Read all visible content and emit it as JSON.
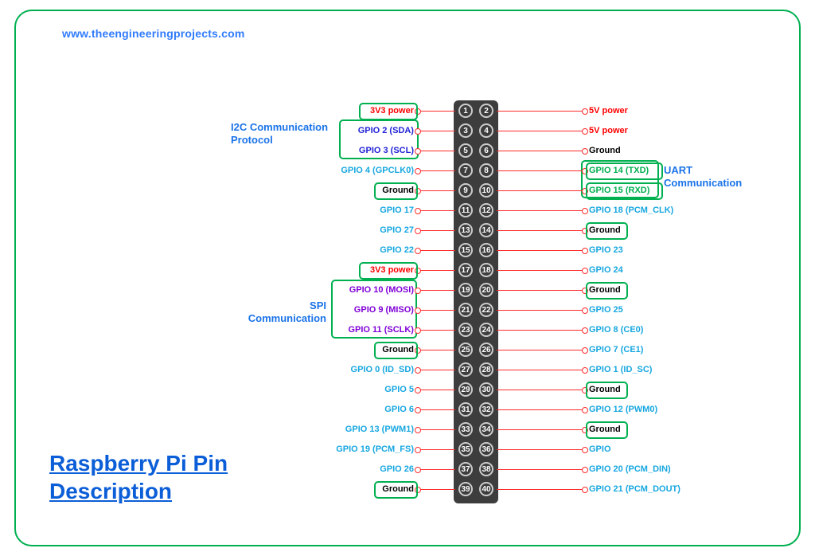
{
  "url": "www.theengineeringprojects.com",
  "title": "Raspberry Pi Pin Description",
  "groups": {
    "i2c": "I2C Communication Protocol",
    "spi": "SPI Communication",
    "uart": "UART Communication"
  },
  "rows": [
    {
      "l": {
        "n": 1,
        "t": "3V3 power",
        "c": "red",
        "box": 1
      },
      "r": {
        "n": 2,
        "t": "5V power",
        "c": "red"
      }
    },
    {
      "l": {
        "n": 3,
        "t": "GPIO 2 (SDA)",
        "c": "blue"
      },
      "r": {
        "n": 4,
        "t": "5V power",
        "c": "red"
      }
    },
    {
      "l": {
        "n": 5,
        "t": "GPIO 3 (SCL)",
        "c": "blue"
      },
      "r": {
        "n": 6,
        "t": "Ground",
        "c": "black"
      }
    },
    {
      "l": {
        "n": 7,
        "t": "GPIO 4 (GPCLK0)",
        "c": "cyan"
      },
      "r": {
        "n": 8,
        "t": "GPIO 14 (TXD)",
        "c": "green",
        "box": 1
      }
    },
    {
      "l": {
        "n": 9,
        "t": "Ground",
        "c": "black",
        "box": 1
      },
      "r": {
        "n": 10,
        "t": "GPIO 15 (RXD)",
        "c": "green",
        "box": 1
      }
    },
    {
      "l": {
        "n": 11,
        "t": "GPIO 17",
        "c": "cyan"
      },
      "r": {
        "n": 12,
        "t": "GPIO 18 (PCM_CLK)",
        "c": "cyan"
      }
    },
    {
      "l": {
        "n": 13,
        "t": "GPIO 27",
        "c": "cyan"
      },
      "r": {
        "n": 14,
        "t": "Ground",
        "c": "black",
        "box": 1
      }
    },
    {
      "l": {
        "n": 15,
        "t": "GPIO 22",
        "c": "cyan"
      },
      "r": {
        "n": 16,
        "t": "GPIO 23",
        "c": "cyan"
      }
    },
    {
      "l": {
        "n": 17,
        "t": "3V3 power",
        "c": "red",
        "box": 1
      },
      "r": {
        "n": 18,
        "t": "GPIO 24",
        "c": "cyan"
      }
    },
    {
      "l": {
        "n": 19,
        "t": "GPIO 10 (MOSI)",
        "c": "purple"
      },
      "r": {
        "n": 20,
        "t": "Ground",
        "c": "black",
        "box": 1
      }
    },
    {
      "l": {
        "n": 21,
        "t": "GPIO 9 (MISO)",
        "c": "purple"
      },
      "r": {
        "n": 22,
        "t": "GPIO 25",
        "c": "cyan"
      }
    },
    {
      "l": {
        "n": 23,
        "t": "GPIO 11 (SCLK)",
        "c": "purple"
      },
      "r": {
        "n": 24,
        "t": "GPIO 8 (CE0)",
        "c": "cyan"
      }
    },
    {
      "l": {
        "n": 25,
        "t": "Ground",
        "c": "black",
        "box": 1
      },
      "r": {
        "n": 26,
        "t": "GPIO 7 (CE1)",
        "c": "cyan"
      }
    },
    {
      "l": {
        "n": 27,
        "t": "GPIO 0 (ID_SD)",
        "c": "cyan"
      },
      "r": {
        "n": 28,
        "t": "GPIO 1 (ID_SC)",
        "c": "cyan"
      }
    },
    {
      "l": {
        "n": 29,
        "t": "GPIO 5",
        "c": "cyan"
      },
      "r": {
        "n": 30,
        "t": "Ground",
        "c": "black",
        "box": 1
      }
    },
    {
      "l": {
        "n": 31,
        "t": "GPIO 6",
        "c": "cyan"
      },
      "r": {
        "n": 32,
        "t": "GPIO 12 (PWM0)",
        "c": "cyan"
      }
    },
    {
      "l": {
        "n": 33,
        "t": "GPIO 13 (PWM1)",
        "c": "cyan"
      },
      "r": {
        "n": 34,
        "t": "Ground",
        "c": "black",
        "box": 1
      }
    },
    {
      "l": {
        "n": 35,
        "t": "GPIO 19 (PCM_FS)",
        "c": "cyan"
      },
      "r": {
        "n": 36,
        "t": "GPIO",
        "c": "cyan"
      }
    },
    {
      "l": {
        "n": 37,
        "t": "GPIO 26",
        "c": "cyan"
      },
      "r": {
        "n": 38,
        "t": "GPIO 20 (PCM_DIN)",
        "c": "cyan"
      }
    },
    {
      "l": {
        "n": 39,
        "t": "Ground",
        "c": "black",
        "box": 1
      },
      "r": {
        "n": 40,
        "t": "GPIO 21 (PCM_DOUT)",
        "c": "cyan"
      }
    }
  ]
}
